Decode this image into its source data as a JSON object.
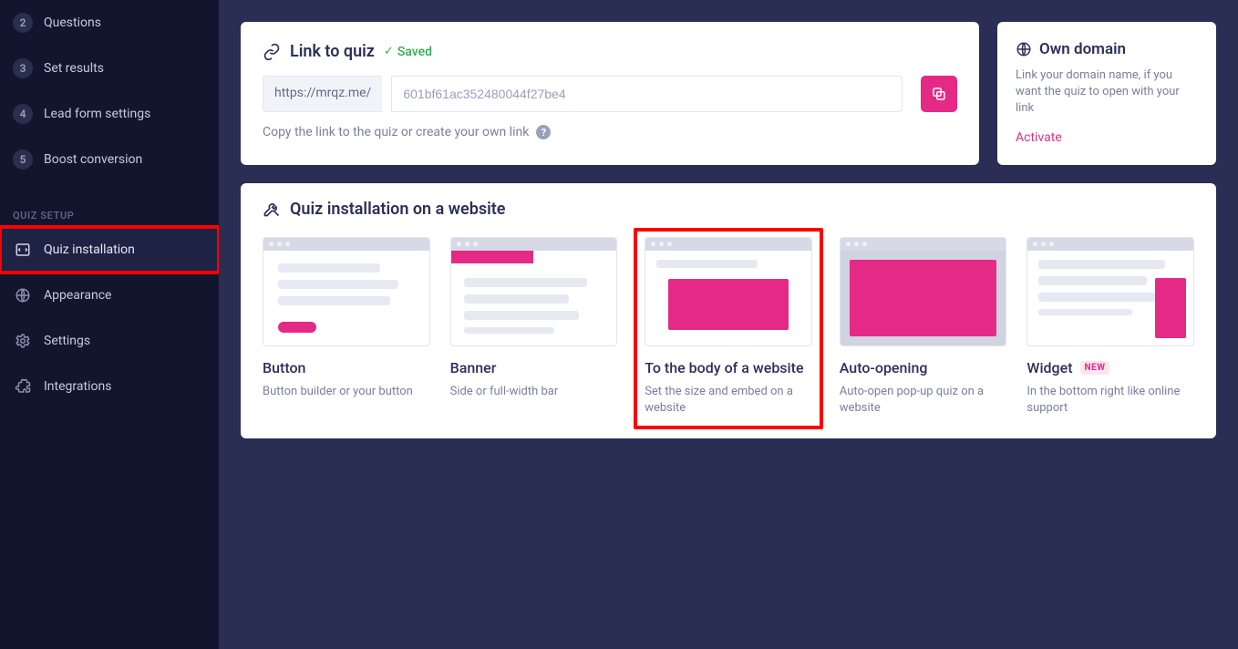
{
  "sidebar": {
    "steps": [
      {
        "num": "2",
        "label": "Questions"
      },
      {
        "num": "3",
        "label": "Set results"
      },
      {
        "num": "4",
        "label": "Lead form settings"
      },
      {
        "num": "5",
        "label": "Boost conversion"
      }
    ],
    "section_label": "QUIZ SETUP",
    "setup": [
      {
        "key": "quiz-installation",
        "label": "Quiz installation",
        "active": true
      },
      {
        "key": "appearance",
        "label": "Appearance"
      },
      {
        "key": "settings",
        "label": "Settings"
      },
      {
        "key": "integrations",
        "label": "Integrations"
      }
    ]
  },
  "link_card": {
    "title": "Link to quiz",
    "saved_label": "Saved",
    "url_prefix": "https://mrqz.me/",
    "url_value": "601bf61ac352480044f27be4",
    "help_text": "Copy the link to the quiz or create your own link"
  },
  "domain_card": {
    "title": "Own domain",
    "desc": "Link your domain name, if you want the quiz to open with your link",
    "action": "Activate"
  },
  "install": {
    "title": "Quiz installation on a website",
    "options": [
      {
        "key": "button",
        "title": "Button",
        "desc": "Button builder or your button"
      },
      {
        "key": "banner",
        "title": "Banner",
        "desc": "Side or full-width bar"
      },
      {
        "key": "body",
        "title": "To the body of a website",
        "desc": "Set the size and embed on a website",
        "highlight": true
      },
      {
        "key": "auto",
        "title": "Auto-opening",
        "desc": "Auto-open pop-up quiz on a website"
      },
      {
        "key": "widget",
        "title": "Widget",
        "desc": "In the bottom right like online support",
        "badge": "NEW"
      }
    ]
  }
}
